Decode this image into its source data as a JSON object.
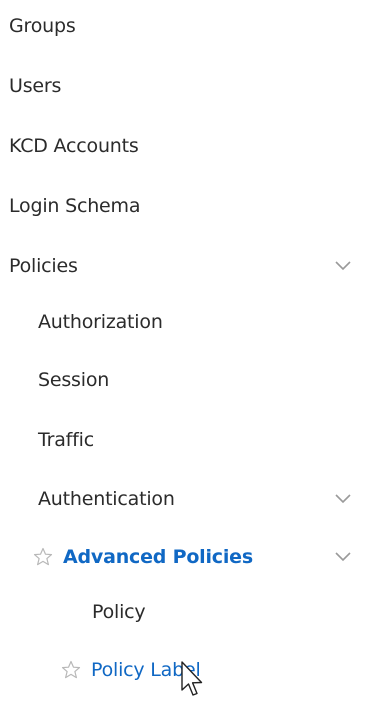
{
  "nav": {
    "items": [
      {
        "label": "Groups"
      },
      {
        "label": "Users"
      },
      {
        "label": "KCD Accounts"
      },
      {
        "label": "Login Schema"
      },
      {
        "label": "Policies"
      },
      {
        "label": "Authorization"
      },
      {
        "label": "Session"
      },
      {
        "label": "Traffic"
      },
      {
        "label": "Authentication"
      },
      {
        "label": "Advanced Policies"
      },
      {
        "label": "Policy"
      },
      {
        "label": "Policy Label"
      }
    ]
  },
  "colors": {
    "accent": "#1068c4",
    "text": "#2b2b2b",
    "icon": "#b8b8b8"
  },
  "icons": {
    "expand": "chevron-down-icon",
    "favorite": "star-icon",
    "cursor": "mouse-pointer-icon"
  }
}
